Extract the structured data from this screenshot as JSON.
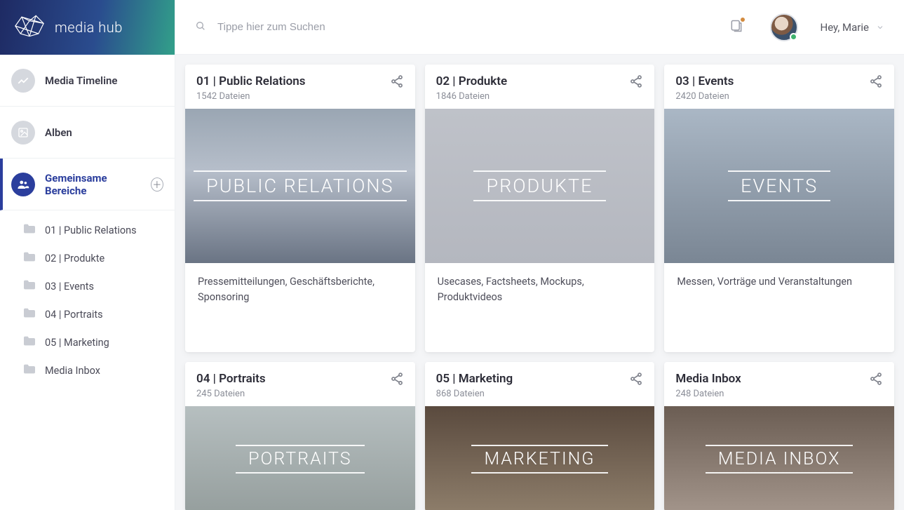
{
  "brand": {
    "title": "media hub"
  },
  "search": {
    "placeholder": "Tippe hier zum Suchen"
  },
  "user": {
    "greeting": "Hey, Marie"
  },
  "nav": {
    "timeline": "Media Timeline",
    "albums": "Alben",
    "shared": "Gemeinsame Bereiche"
  },
  "sidebar_items": [
    {
      "label": "01 | Public Relations"
    },
    {
      "label": "02 | Produkte"
    },
    {
      "label": "03 | Events"
    },
    {
      "label": "04 | Portraits"
    },
    {
      "label": "05 | Marketing"
    },
    {
      "label": "Media Inbox"
    }
  ],
  "cards": [
    {
      "title": "01 | Public Relations",
      "count": "1542 Dateien",
      "overlay": "PUBLIC RELATIONS",
      "desc": "Pressemitteilungen, Geschäftsberichte, Sponsoring"
    },
    {
      "title": "02 | Produkte",
      "count": "1846 Dateien",
      "overlay": "PRODUKTE",
      "desc": "Usecases, Factsheets, Mockups, Produktvideos"
    },
    {
      "title": "03 | Events",
      "count": "2420 Dateien",
      "overlay": "EVENTS",
      "desc": "Messen, Vorträge und Veranstaltungen"
    },
    {
      "title": "04 | Portraits",
      "count": "245 Dateien",
      "overlay": "PORTRAITS",
      "desc": ""
    },
    {
      "title": "05 | Marketing",
      "count": "868 Dateien",
      "overlay": "MARKETING",
      "desc": ""
    },
    {
      "title": "Media Inbox",
      "count": "248 Dateien",
      "overlay": "MEDIA INBOX",
      "desc": ""
    }
  ]
}
